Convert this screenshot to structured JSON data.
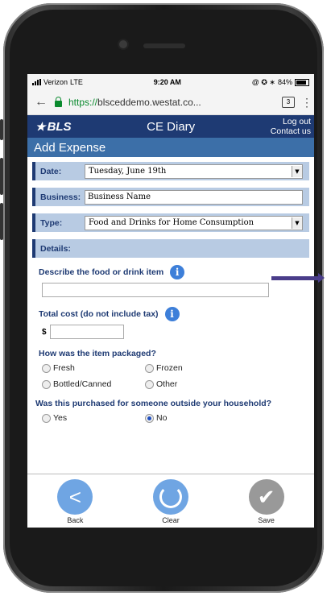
{
  "status_bar": {
    "carrier": "Verizon",
    "network": "LTE",
    "time": "9:20 AM",
    "icons": "@ ✪ ∗",
    "battery": "84%"
  },
  "browser": {
    "url_https": "https://",
    "url_rest": "blsceddemo.westat.co...",
    "tab_count": "3",
    "menu": "⋮"
  },
  "header": {
    "logo": "BLS",
    "title": "CE Diary",
    "logout": "Log out",
    "contact": "Contact us"
  },
  "page_title": "Add Expense",
  "form": {
    "date_label": "Date:",
    "date_value": "Tuesday, June 19th",
    "business_label": "Business:",
    "business_value": "Business Name",
    "type_label": "Type:",
    "type_value": "Food and Drinks for Home Consumption",
    "details_label": "Details:",
    "describe_label": "Describe the food or drink item",
    "cost_label": "Total cost (do not include tax)",
    "currency": "$",
    "packaged_q": "How was the item packaged?",
    "pack_options": [
      "Fresh",
      "Frozen",
      "Bottled/Canned",
      "Other"
    ],
    "outside_q": "Was this purchased for someone outside your household?",
    "outside_options": [
      "Yes",
      "No"
    ],
    "outside_selected": "No"
  },
  "footer": {
    "back": "Back",
    "clear": "Clear",
    "save": "Save"
  },
  "colors": {
    "header": "#1e3a73",
    "subheader": "#3c6fa8",
    "row_bg": "#b8cbe3",
    "button_blue": "#6fa5e3",
    "button_grey": "#999999",
    "pointer_arrow": "#4a3d8a"
  }
}
